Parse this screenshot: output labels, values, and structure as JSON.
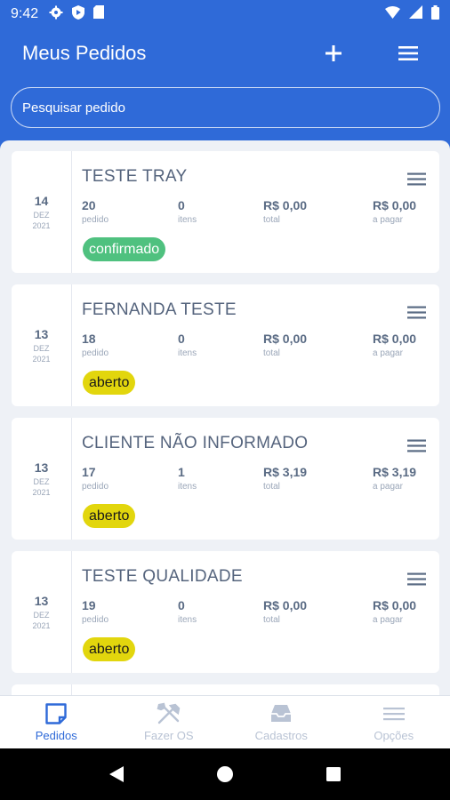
{
  "status": {
    "time": "9:42"
  },
  "header": {
    "title": "Meus Pedidos"
  },
  "search": {
    "placeholder": "Pesquisar pedido"
  },
  "orders": [
    {
      "day": "14",
      "month": "DEZ",
      "year": "2021",
      "client": "TESTE TRAY",
      "pedido": "20",
      "pedido_label": "pedido",
      "itens": "0",
      "itens_label": "itens",
      "total": "R$ 0,00",
      "total_label": "total",
      "a_pagar": "R$ 0,00",
      "a_pagar_label": "a pagar",
      "status": "confirmado"
    },
    {
      "day": "13",
      "month": "DEZ",
      "year": "2021",
      "client": "FERNANDA TESTE",
      "pedido": "18",
      "pedido_label": "pedido",
      "itens": "0",
      "itens_label": "itens",
      "total": "R$ 0,00",
      "total_label": "total",
      "a_pagar": "R$ 0,00",
      "a_pagar_label": "a pagar",
      "status": "aberto"
    },
    {
      "day": "13",
      "month": "DEZ",
      "year": "2021",
      "client": "CLIENTE NÃO INFORMADO",
      "pedido": "17",
      "pedido_label": "pedido",
      "itens": "1",
      "itens_label": "itens",
      "total": "R$ 3,19",
      "total_label": "total",
      "a_pagar": "R$ 3,19",
      "a_pagar_label": "a pagar",
      "status": "aberto"
    },
    {
      "day": "13",
      "month": "DEZ",
      "year": "2021",
      "client": "TESTE QUALIDADE",
      "pedido": "19",
      "pedido_label": "pedido",
      "itens": "0",
      "itens_label": "itens",
      "total": "R$ 0,00",
      "total_label": "total",
      "a_pagar": "R$ 0,00",
      "a_pagar_label": "a pagar",
      "status": "aberto"
    }
  ],
  "bottom_nav": [
    {
      "label": "Pedidos",
      "icon": "orders-icon",
      "active": true
    },
    {
      "label": "Fazer OS",
      "icon": "tools-icon",
      "active": false
    },
    {
      "label": "Cadastros",
      "icon": "inbox-icon",
      "active": false
    },
    {
      "label": "Opções",
      "icon": "menu-icon",
      "active": false
    }
  ],
  "colors": {
    "primary": "#2f6ad8",
    "confirmed": "#4fc17f",
    "open": "#e2d60d"
  }
}
